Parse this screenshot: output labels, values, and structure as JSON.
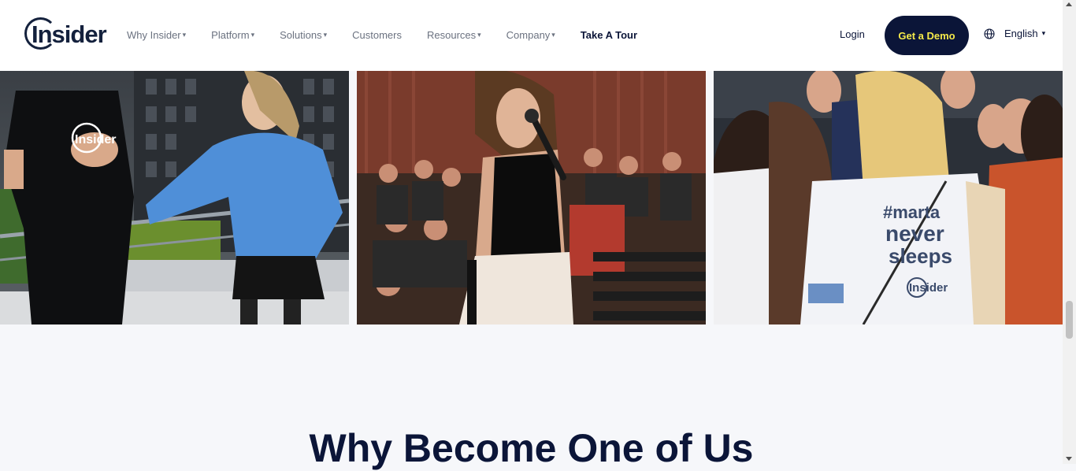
{
  "header": {
    "logo_text": "Insider",
    "nav": [
      {
        "label": "Why Insider",
        "has_dropdown": true
      },
      {
        "label": "Platform",
        "has_dropdown": true
      },
      {
        "label": "Solutions",
        "has_dropdown": true
      },
      {
        "label": "Customers",
        "has_dropdown": false
      },
      {
        "label": "Resources",
        "has_dropdown": true
      },
      {
        "label": "Company",
        "has_dropdown": true
      },
      {
        "label": "Take A Tour",
        "has_dropdown": false
      }
    ],
    "login_label": "Login",
    "demo_label": "Get a Demo",
    "language": "English",
    "caret": "▾"
  },
  "photos": [
    {
      "name": "team-rooftop-photo",
      "shirt_text": "Insider"
    },
    {
      "name": "speaker-microphone-photo"
    },
    {
      "name": "event-crowd-photo",
      "shirt_text": [
        "#marta",
        "never",
        "sleeps",
        "Insider"
      ]
    }
  ],
  "section": {
    "title": "Why Become One of Us"
  },
  "colors": {
    "navy": "#0b1538",
    "accent_yellow": "#f4e94a",
    "background": "#f6f7fa"
  }
}
